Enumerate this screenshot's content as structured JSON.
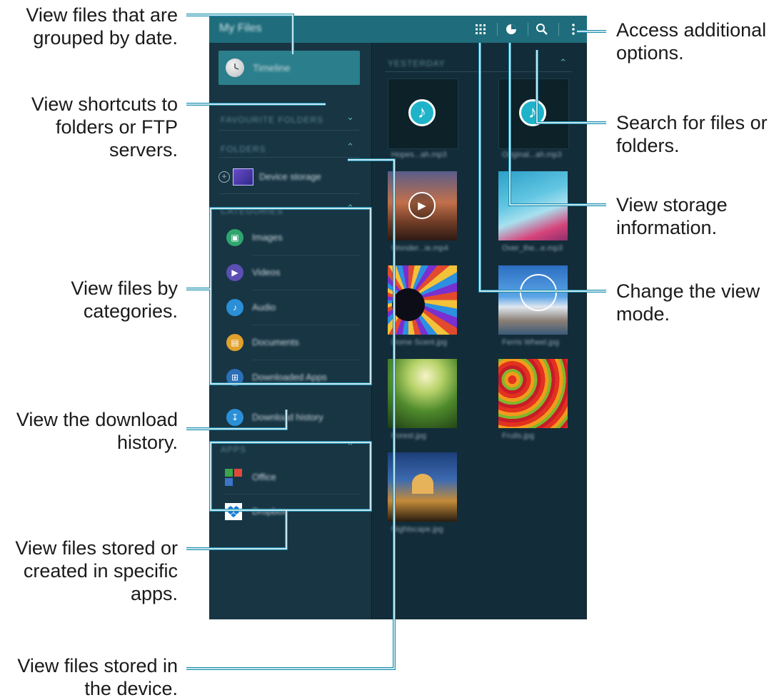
{
  "app": {
    "title": "My Files",
    "toolbar": {
      "view_mode_icon": "grid-icon",
      "storage_icon": "pie-chart-icon",
      "search_icon": "search-icon",
      "more_icon": "more-vert-icon"
    }
  },
  "sidebar": {
    "timeline_label": "Timeline",
    "favourite_folders_header": "FAVOURITE FOLDERS",
    "folders_header": "FOLDERS",
    "device_storage_label": "Device storage",
    "categories_header": "CATEGORIES",
    "categories": [
      {
        "label": "Images",
        "icon": "image-icon",
        "color": "#2fa66e"
      },
      {
        "label": "Videos",
        "icon": "video-icon",
        "color": "#5b4fb4"
      },
      {
        "label": "Audio",
        "icon": "music-note-icon",
        "color": "#2a8fd6"
      },
      {
        "label": "Documents",
        "icon": "document-icon",
        "color": "#e0a12d"
      },
      {
        "label": "Downloaded Apps",
        "icon": "downloaded-apps-icon",
        "color": "#2b6fb8"
      }
    ],
    "download_history_label": "Download history",
    "apps_header": "APPS",
    "apps": [
      {
        "label": "Office",
        "icon": "office-icon"
      },
      {
        "label": "Dropbox",
        "icon": "dropbox-icon"
      }
    ]
  },
  "content": {
    "section_header": "YESTERDAY",
    "files": [
      {
        "caption": "Hopes...ah.mp3",
        "kind": "audio"
      },
      {
        "caption": "Original...ah.mp3",
        "kind": "audio"
      },
      {
        "caption": "Wonder...ie.mp4",
        "kind": "video"
      },
      {
        "caption": "Over_the...e.mp3",
        "kind": "image"
      },
      {
        "caption": "Dome Scent.jpg",
        "kind": "image"
      },
      {
        "caption": "Ferris Wheel.jpg",
        "kind": "image"
      },
      {
        "caption": "Forest.jpg",
        "kind": "image"
      },
      {
        "caption": "Fruits.jpg",
        "kind": "image"
      },
      {
        "caption": "Nightscape.jpg",
        "kind": "image"
      }
    ]
  },
  "annotations": {
    "grouped_by_date": "View files that are grouped by date.",
    "shortcuts": "View shortcuts to folders or FTP servers.",
    "by_categories": "View files by categories.",
    "download_history": "View the download history.",
    "specific_apps": "View files stored or created in specific apps.",
    "in_device": "View files stored in the device.",
    "additional_options": "Access additional options.",
    "search": "Search for files or folders.",
    "storage_info": "View storage information.",
    "view_mode": "Change the view mode."
  },
  "colors": {
    "annotation_line": "#1a8fb0",
    "topbar": "#1f6d7c",
    "screen_background": "#112a35"
  }
}
